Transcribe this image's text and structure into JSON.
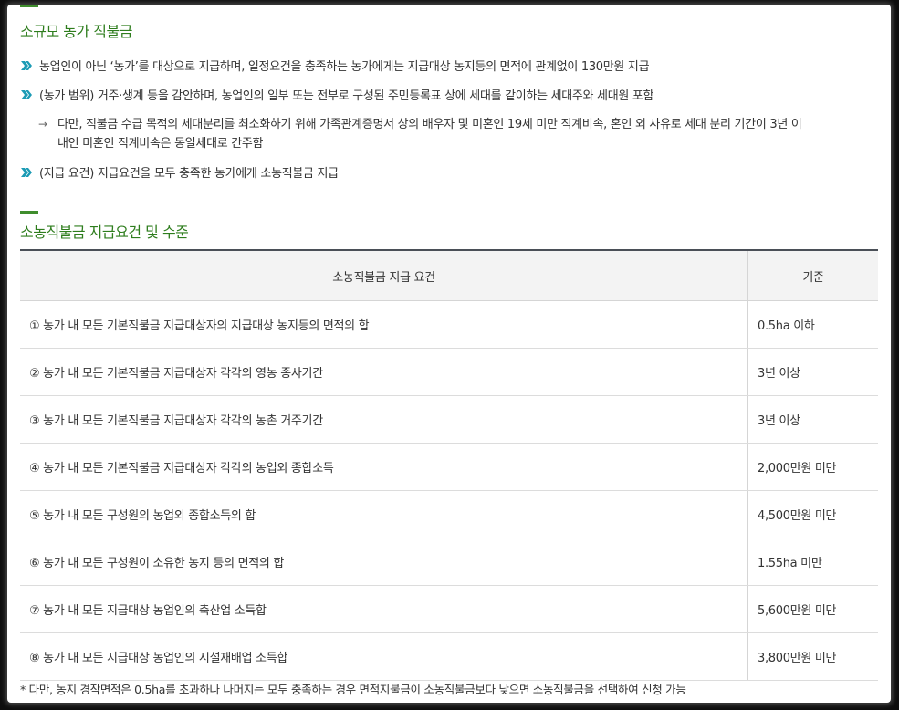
{
  "colors": {
    "accent": "#3f8d2d",
    "title": "#2e7d1d",
    "chevron": "#1c9bb5",
    "table_header_bg": "#f3f3f3",
    "table_top_border": "#4a4f57"
  },
  "section1": {
    "title": "소규모 농가 직불금",
    "bullets": [
      "농업인이 아닌 ‘농가’를 대상으로 지급하며, 일정요건을 충족하는 농가에게는 지급대상 농지등의 면적에 관계없이 130만원 지급",
      "(농가 범위) 거주·생계 등을 감안하며, 농업인의 일부 또는 전부로 구성된 주민등록표 상에 세대를 같이하는 세대주와 세대원 포함"
    ],
    "sub_arrow": "→",
    "sub_note_line1": "다만, 직불금 수급 목적의 세대분리를 최소화하기 위해 가족관계증명서 상의 배우자 및 미혼인 19세 미만 직계비속, 혼인 외 사유로 세대 분리 기간이 3년 이",
    "sub_note_line2": "내인 미혼인 직계비속은 동일세대로 간주함",
    "bullet3": "(지급 요건) 지급요건을 모두 충족한 농가에게 소농직불금 지급"
  },
  "section2": {
    "title": "소농직불금 지급요건 및 수준",
    "table": {
      "headers": [
        "소농직불금 지급 요건",
        "기준"
      ],
      "rows": [
        {
          "requirement": "① 농가 내 모든 기본직불금 지급대상자의 지급대상 농지등의 면적의 합",
          "standard": "0.5ha 이하"
        },
        {
          "requirement": "② 농가 내 모든 기본직불금 지급대상자 각각의 영농 종사기간",
          "standard": "3년 이상"
        },
        {
          "requirement": "③ 농가 내 모든 기본직불금 지급대상자 각각의 농촌 거주기간",
          "standard": "3년 이상"
        },
        {
          "requirement": "④ 농가 내 모든 기본직불금 지급대상자 각각의 농업외 종합소득",
          "standard": "2,000만원 미만"
        },
        {
          "requirement": "⑤ 농가 내 모든 구성원의 농업외 종합소득의 합",
          "standard": "4,500만원 미만"
        },
        {
          "requirement": "⑥ 농가 내 모든 구성원이 소유한 농지 등의 면적의 합",
          "standard": "1.55ha 미만"
        },
        {
          "requirement": "⑦ 농가 내 모든 지급대상 농업인의 축산업 소득합",
          "standard": "5,600만원 미만"
        },
        {
          "requirement": "⑧ 농가 내 모든 지급대상 농업인의 시설재배업 소득합",
          "standard": "3,800만원 미만"
        }
      ]
    },
    "footnote": "* 다만, 농지 경작면적은 0.5ha를 초과하나 나머지는 모두 충족하는 경우 면적지불금이 소농직불금보다 낮으면 소농직불금을 선택하여 신청 가능"
  }
}
